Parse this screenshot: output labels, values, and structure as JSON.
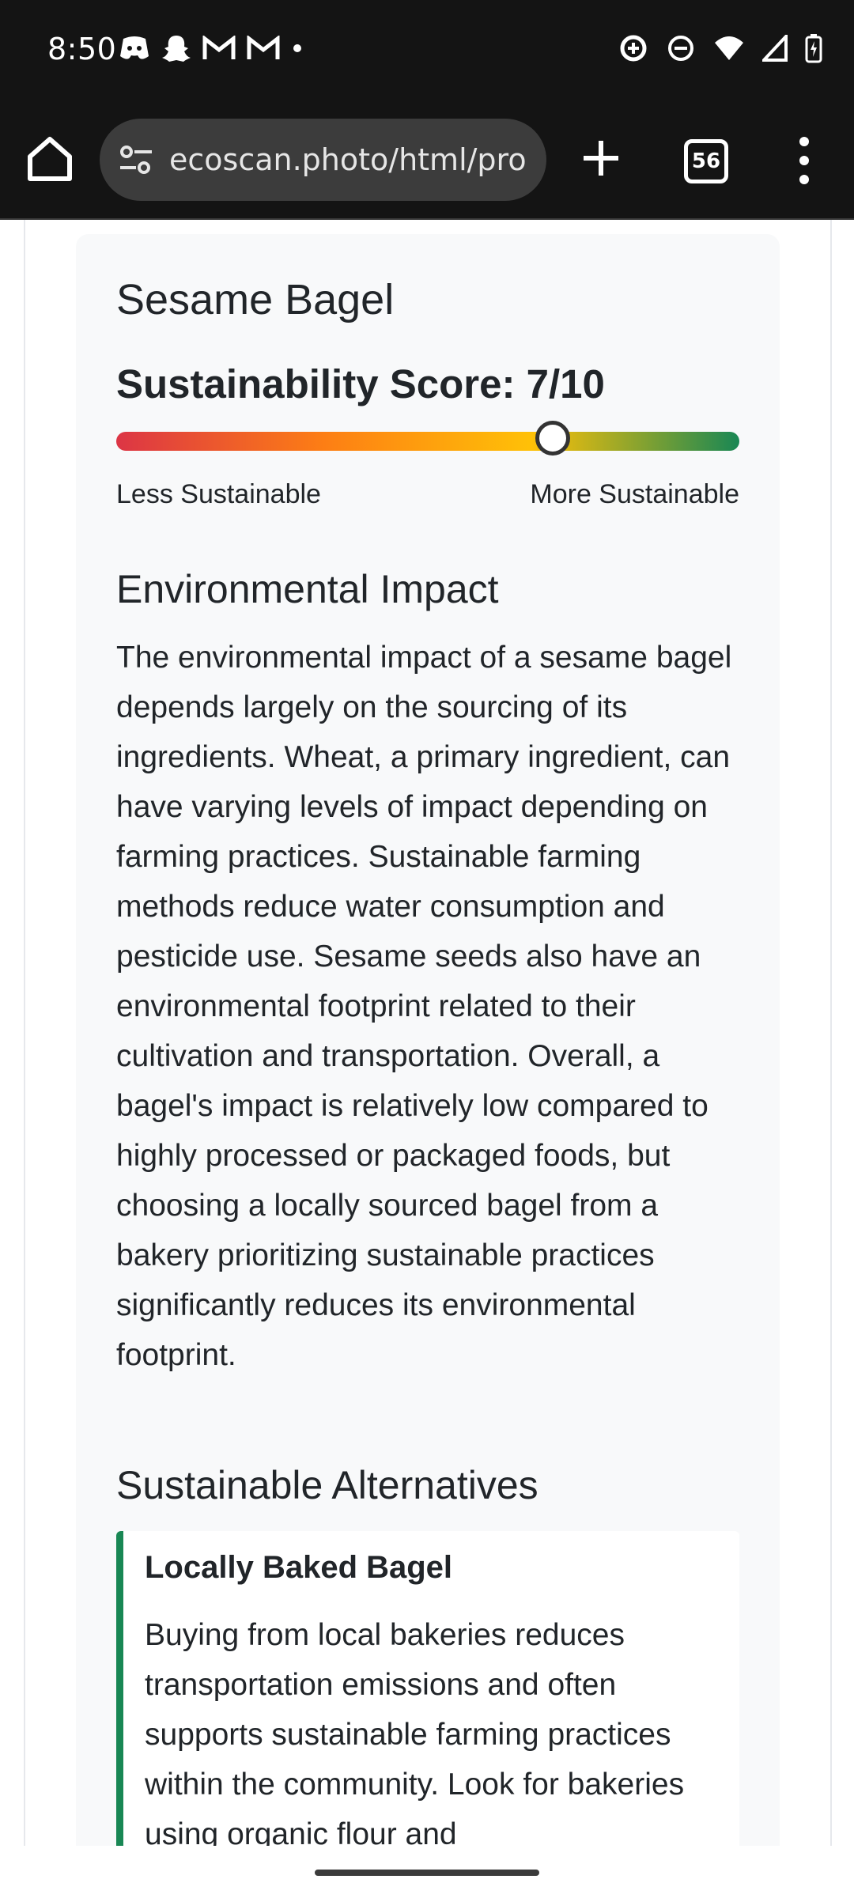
{
  "status_bar": {
    "time": "8:50",
    "left_icons": [
      "discord-icon",
      "snapchat-icon",
      "gmail-icon",
      "gmail-icon",
      "dot-icon"
    ],
    "right_icons": [
      "data-saver-icon",
      "do-not-disturb-icon",
      "wifi-icon",
      "signal-icon",
      "battery-charging-icon"
    ]
  },
  "browser": {
    "url": "ecoscan.photo/html/pro",
    "tab_count": "56",
    "icons": [
      "home-icon",
      "tune-icon",
      "plus-icon",
      "tabs-icon",
      "more-vert-icon"
    ]
  },
  "product": {
    "name": "Sesame Bagel",
    "score_label": "Sustainability Score: 7/10",
    "score_value": 7,
    "score_max": 10,
    "scale_low_label": "Less Sustainable",
    "scale_high_label": "More Sustainable",
    "gradient_colors": [
      "#dc3545",
      "#fd7e14",
      "#ffc107",
      "#198754"
    ]
  },
  "environmental_impact": {
    "heading": "Environmental Impact",
    "text": "The environmental impact of a sesame bagel depends largely on the sourcing of its ingredients. Wheat, a primary ingredient, can have varying levels of impact depending on farming practices. Sustainable farming methods reduce water consumption and pesticide use. Sesame seeds also have an environmental footprint related to their cultivation and transportation. Overall, a bagel's impact is relatively low compared to highly processed or packaged foods, but choosing a locally sourced bagel from a bakery prioritizing sustainable practices significantly reduces its environmental footprint."
  },
  "alternatives": {
    "heading": "Sustainable Alternatives",
    "items": [
      {
        "title": "Locally Baked Bagel",
        "text": "Buying from local bakeries reduces transportation emissions and often supports sustainable farming practices within the community. Look for bakeries using organic flour and"
      }
    ],
    "accent_color": "#198754"
  }
}
